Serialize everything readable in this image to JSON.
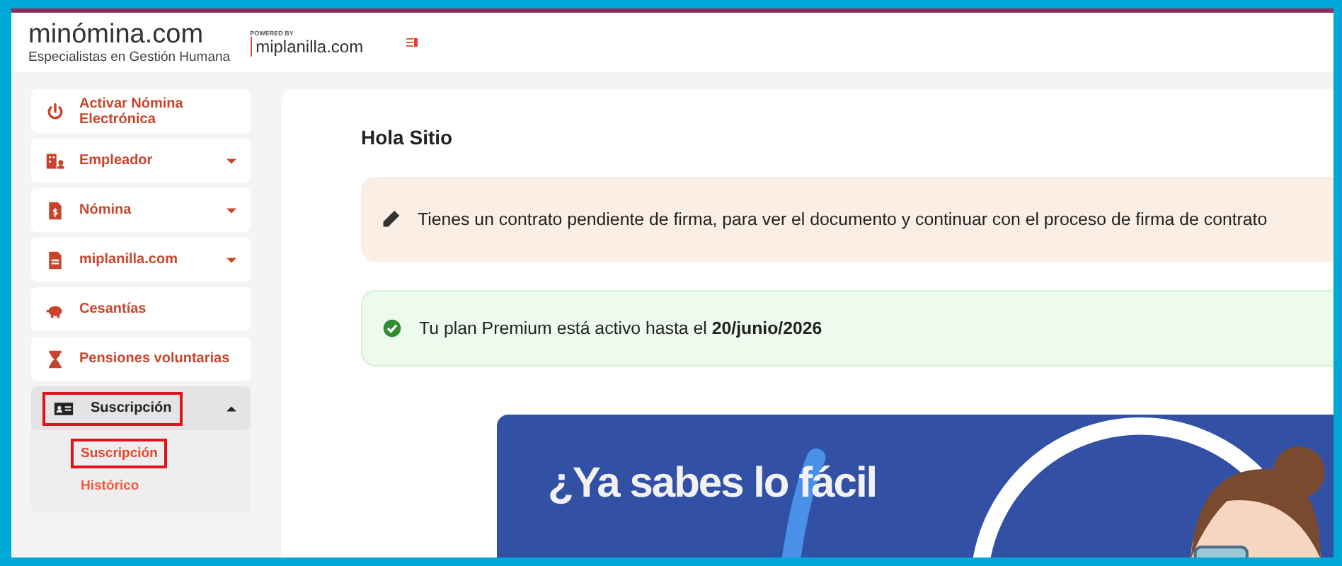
{
  "header": {
    "logo": "minómina.com",
    "tagline": "Especialistas en Gestión Humana",
    "powered_by": "POWERED BY",
    "partner": "miplanilla.com"
  },
  "sidebar": {
    "items": [
      {
        "label": "Activar Nómina Electrónica",
        "kind": "power",
        "expandable": false,
        "expanded": false,
        "highlighted": false
      },
      {
        "label": "Empleador",
        "kind": "building",
        "expandable": true,
        "expanded": false,
        "highlighted": false
      },
      {
        "label": "Nómina",
        "kind": "payroll",
        "expandable": true,
        "expanded": false,
        "highlighted": false
      },
      {
        "label": "miplanilla.com",
        "kind": "document",
        "expandable": true,
        "expanded": false,
        "highlighted": false
      },
      {
        "label": "Cesantías",
        "kind": "piggy",
        "expandable": false,
        "expanded": false,
        "highlighted": false
      },
      {
        "label": "Pensiones voluntarias",
        "kind": "hourglass",
        "expandable": false,
        "expanded": false,
        "highlighted": false
      },
      {
        "label": "Suscripción",
        "kind": "idcard",
        "expandable": true,
        "expanded": true,
        "highlighted": true,
        "children": [
          {
            "label": "Suscripción",
            "selected": true,
            "highlighted": true
          },
          {
            "label": "Histórico",
            "selected": false,
            "highlighted": false
          }
        ]
      }
    ]
  },
  "main": {
    "greeting": "Hola Sitio",
    "alerts": [
      {
        "kind": "warning",
        "text": "Tienes un contrato pendiente de firma, para ver el documento y continuar con el proceso de firma de contrato"
      },
      {
        "kind": "success",
        "text": "Tu plan Premium está activo hasta el  **20/junio/2026**"
      }
    ],
    "banner": {
      "headline": "¿Ya sabes lo fácil"
    }
  }
}
